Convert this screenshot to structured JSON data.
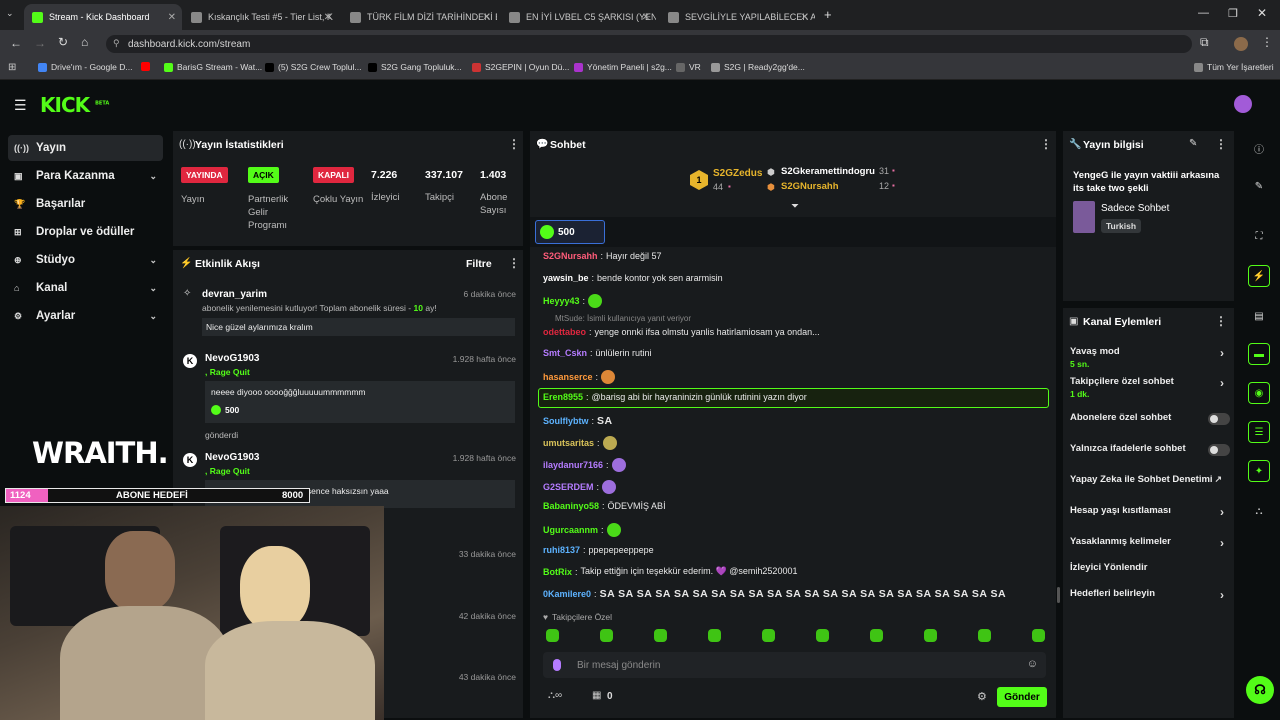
{
  "browser": {
    "tabs": [
      {
        "label": "Stream - Kick Dashboard",
        "color": "#53fc18"
      },
      {
        "label": "Kıskançlık Testi #5 - Tier List, K",
        "color": "#888"
      },
      {
        "label": "TÜRK FİLM DİZİ TARİHİNDEKİ E",
        "color": "#888"
      },
      {
        "label": "EN İYİ LVBEL C5 ŞARKISI (YENİ",
        "color": "#888"
      },
      {
        "label": "SEVGİLİYLE YAPILABİLECEK AKT",
        "color": "#888"
      }
    ],
    "url": "dashboard.kick.com/stream",
    "bookmarks": [
      {
        "label": "Drive'ım - Google D...",
        "color": "#4285f4"
      },
      {
        "label": "",
        "color": "#ff0000"
      },
      {
        "label": "BarisG Stream - Wat...",
        "color": "#53fc18"
      },
      {
        "label": "(5) S2G Crew Toplul...",
        "color": "#000"
      },
      {
        "label": "S2G Gang Topluluk...",
        "color": "#000"
      },
      {
        "label": "S2GEPIN | Oyun Dü...",
        "color": "#c33"
      },
      {
        "label": "Yönetim Paneli | s2g...",
        "color": "#a3c"
      },
      {
        "label": "VR",
        "color": "#666"
      },
      {
        "label": "S2G | Ready2gg'de...",
        "color": "#999"
      },
      {
        "label": "Tüm Yer İşaretleri",
        "color": "#888"
      }
    ]
  },
  "app": {
    "logo": "KICK",
    "logo_sup": "BETA",
    "sidebar": [
      {
        "label": "Yayın",
        "icon": "broadcast-icon",
        "glyph": "((·))",
        "chev": false
      },
      {
        "label": "Para Kazanma",
        "icon": "money-icon",
        "glyph": "▣",
        "chev": true
      },
      {
        "label": "Başarılar",
        "icon": "trophy-icon",
        "glyph": "🏆",
        "chev": false
      },
      {
        "label": "Droplar ve ödüller",
        "icon": "gift-icon",
        "glyph": "⊞",
        "chev": false
      },
      {
        "label": "Stüdyo",
        "icon": "studio-icon",
        "glyph": "⊕",
        "chev": true
      },
      {
        "label": "Kanal",
        "icon": "channel-icon",
        "glyph": "⌂",
        "chev": true
      },
      {
        "label": "Ayarlar",
        "icon": "settings-icon",
        "glyph": "⚙",
        "chev": true
      }
    ]
  },
  "stats": {
    "title": "Yayın İstatistikleri",
    "items": [
      {
        "badge": "YAYINDA",
        "badge_color": "#e0273f",
        "label": "Yayın"
      },
      {
        "badge": "AÇIK",
        "badge_color": "#53fc18",
        "label": "Partnerlik Gelir Programı"
      },
      {
        "badge": "KAPALI",
        "badge_color": "#e0273f",
        "label": "Çoklu Yayın"
      },
      {
        "badge": "7.226",
        "badge_color": "",
        "label": "İzleyici"
      },
      {
        "badge": "337.107",
        "badge_color": "",
        "label": "Takipçi"
      },
      {
        "badge": "1.403",
        "badge_color": "",
        "label": "Abone Sayısı"
      }
    ]
  },
  "activity": {
    "title": "Etkinlik Akışı",
    "filter": "Filtre",
    "items": [
      {
        "user": "devran_yarim",
        "time": "6 dakika önce",
        "text": "abonelik yenilemesini kutluyor! Toplam abonelik süresi - ",
        "highlight": "10",
        "tail": " ay!",
        "msg": "Nice güzel aylarımıza kralım"
      },
      {
        "user": "NevoG1903",
        "time": "1.928 hafta önce",
        "sub": ", Rage Quit",
        "msg": "neeee diyooo ooooğğğluuuuummmmmm",
        "amount": "500",
        "foot": "gönderdi"
      },
      {
        "user": "NevoG1903",
        "time": "1.928 hafta önce",
        "sub": ", Rage Quit",
        "msg": "seni hiç dinlemedim ama sence haksızsın yaaa"
      },
      {
        "time": "33 dakika önce"
      },
      {
        "time": "42 dakika önce"
      },
      {
        "time": "43 dakika önce"
      }
    ]
  },
  "overlay": {
    "brand": "WRAITH.",
    "goal_current": "1124",
    "goal_label": "ABONE HEDEFİ",
    "goal_target": "8000",
    "goal_progress": 0.14
  },
  "chat": {
    "title": "Sohbet",
    "top": [
      {
        "rank": "1",
        "name": "S2GZedus",
        "count": "44"
      },
      {
        "name": "S2Gkeramettindogru",
        "count": "31"
      },
      {
        "name": "S2GNursahh",
        "count": "12"
      }
    ],
    "pinned_amount": "500",
    "messages": [
      {
        "user": "S2GNursahh",
        "color": "#ff5c7a",
        "text": "Hayır değil 57"
      },
      {
        "user": "yawsin_be",
        "color": "#ffffff",
        "text": "bende kontor yok sen ararmisin"
      },
      {
        "user": "Heyyy43",
        "color": "#53fc18",
        "text": ""
      },
      {
        "reply": "MtSude: İsimli kullanıcıya yanıt veriyor"
      },
      {
        "user": "odettabeo",
        "color": "#e0273f",
        "text": "yenge onnki ifsa olmstu yanlis hatirlamiosam ya ondan..."
      },
      {
        "user": "Smt_Cskn",
        "color": "#b57cff",
        "text": "ünlülerin rutini"
      },
      {
        "user": "hasanserce",
        "color": "#ff9a3c",
        "text": ""
      },
      {
        "user": "Eren8955",
        "color": "#53fc18",
        "text": "@barisg abi bir hayraninizin günlük rutinini yazın diyor",
        "highlight": true
      },
      {
        "user": "Soulflybtw",
        "color": "#5db3ff",
        "text": "SA"
      },
      {
        "user": "umutsaritas",
        "color": "#d9c35a",
        "text": ""
      },
      {
        "user": "ilaydanur7166",
        "color": "#b57cff",
        "text": ""
      },
      {
        "user": "G2SERDEM",
        "color": "#b57cff",
        "text": ""
      },
      {
        "user": "Babaninyo58",
        "color": "#53fc18",
        "text": "ÖDEVMİŞ ABİ"
      },
      {
        "user": "Ugurcaannm",
        "color": "#53fc18",
        "text": ""
      },
      {
        "user": "ruhi8137",
        "color": "#5db3ff",
        "text": "ppepepeeppepe"
      },
      {
        "user": "BotRix",
        "color": "#53fc18",
        "text": "Takip ettiğin için teşekkür ederim. 💜 @semih2520001"
      },
      {
        "user": "0Kamilere0",
        "color": "#5db3ff",
        "text": "SA SA SA SA SA SA SA SA SA SA SA SA SA SA SA SA SA SA SA SA SA SA"
      }
    ],
    "followers_only": "Takipçilere Özel",
    "input_placeholder": "Bir mesaj gönderin",
    "count": "0",
    "send": "Gönder"
  },
  "info": {
    "title": "Yayın bilgisi",
    "stream_title": "YengeG ile yayın vaktiii arkasına its take two şekli",
    "category": "Sadece Sohbet",
    "tag": "Turkish"
  },
  "actions": {
    "title": "Kanal Eylemleri",
    "rows": [
      {
        "label": "Yavaş mod",
        "sub": "5 sn.",
        "ctrl": "chev"
      },
      {
        "label": "Takipçilere özel sohbet",
        "sub": "1 dk.",
        "ctrl": "chev"
      },
      {
        "label": "Abonelere özel sohbet",
        "sub": "",
        "ctrl": "toggle"
      },
      {
        "label": "Yalnızca ifadelerle sohbet",
        "sub": "",
        "ctrl": "toggle"
      },
      {
        "label": "Yapay Zeka ile Sohbet Denetimi",
        "sub": "",
        "ctrl": "ext"
      },
      {
        "label": "Hesap yaşı kısıtlaması",
        "sub": "",
        "ctrl": "chev"
      },
      {
        "label": "Yasaklanmış kelimeler",
        "sub": "",
        "ctrl": "chev"
      },
      {
        "label": "İzleyici Yönlendir",
        "sub": "",
        "ctrl": ""
      },
      {
        "label": "Hedefleri belirleyin",
        "sub": "",
        "ctrl": "chev"
      }
    ]
  }
}
